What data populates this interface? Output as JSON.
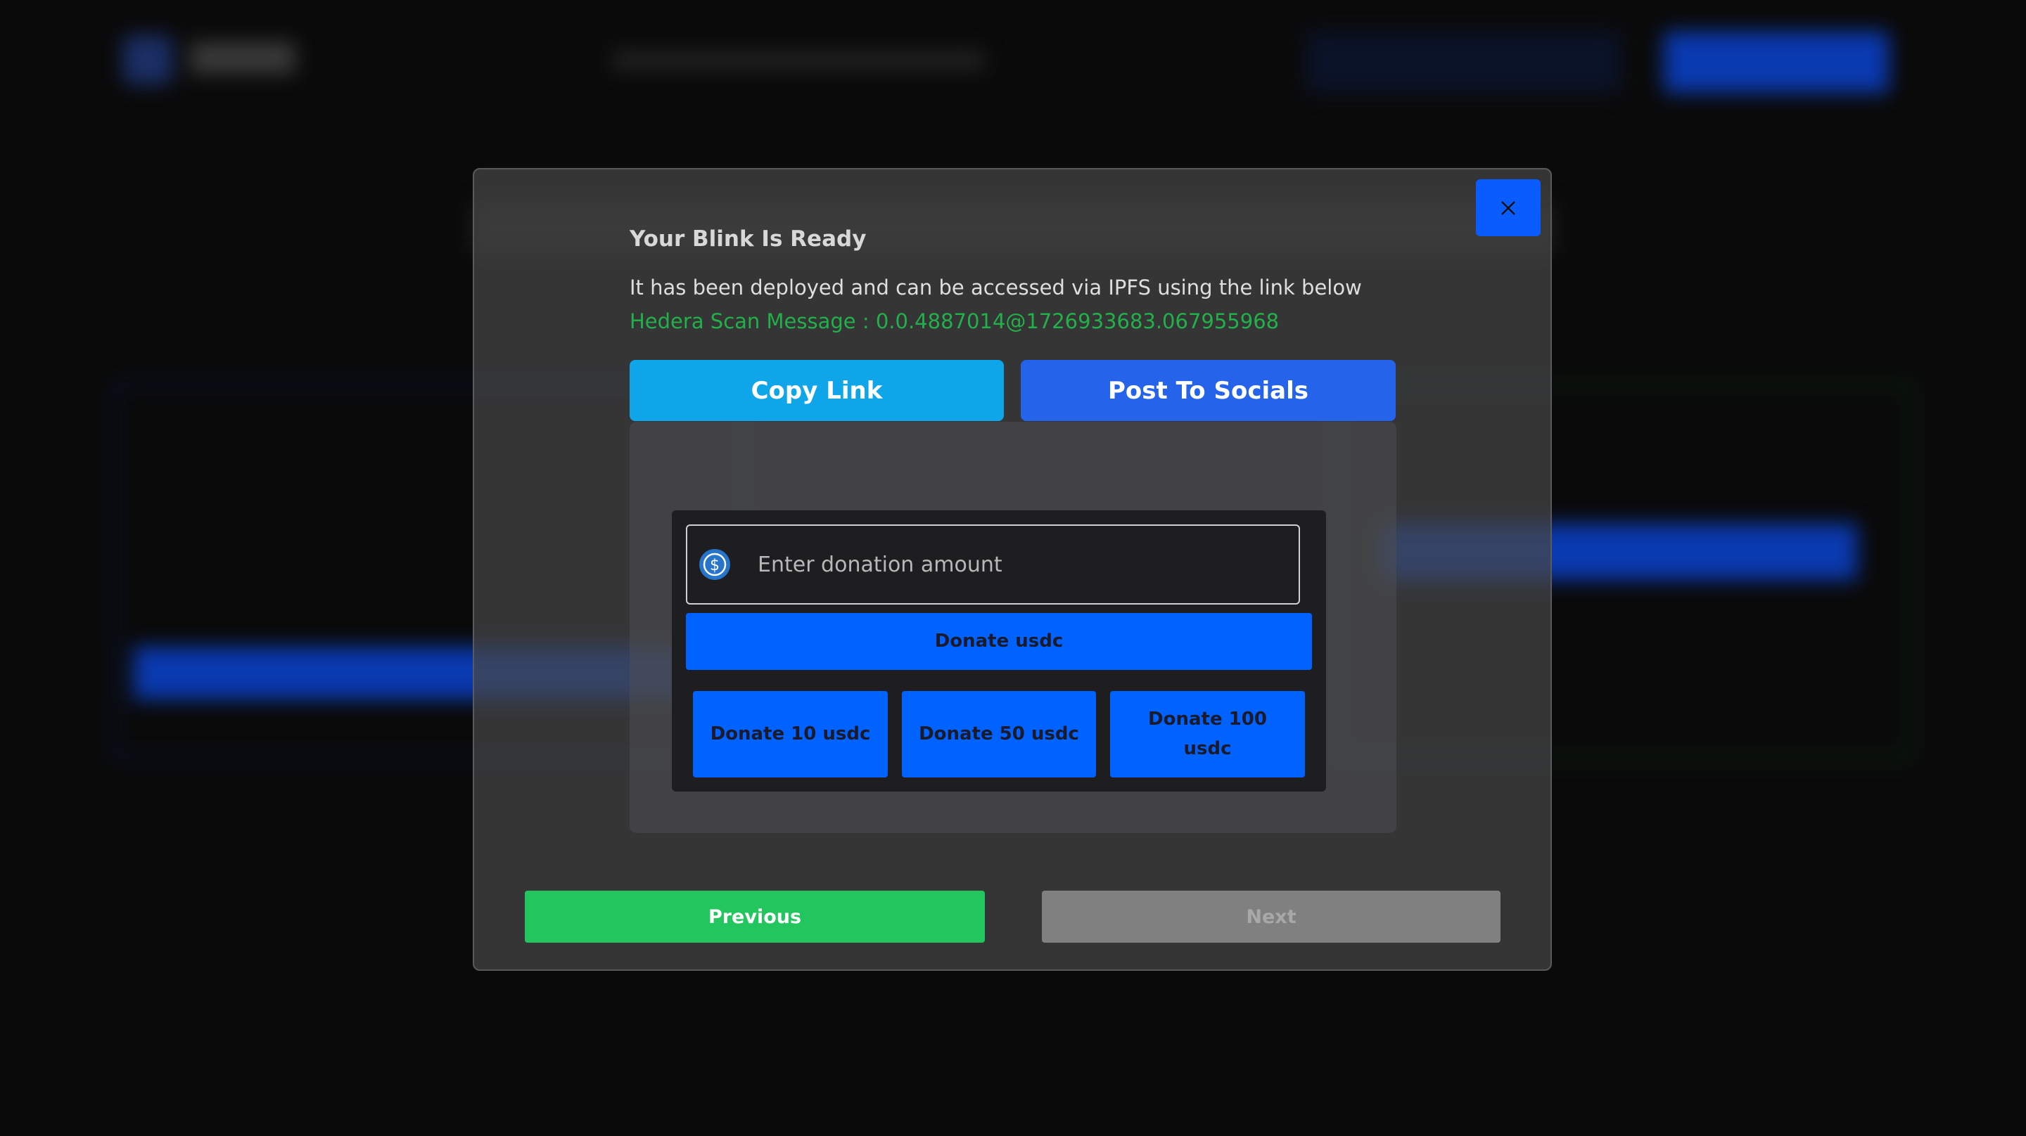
{
  "modal": {
    "title": "Your Blink Is Ready",
    "description": "It has been deployed and can be accessed via IPFS using the link below",
    "hedera_message": "Hedera Scan Message : 0.0.4887014@1726933683.067955968",
    "copy_link_label": "Copy Link",
    "post_socials_label": "Post To Socials",
    "close_icon": "close-icon"
  },
  "donation": {
    "placeholder": "Enter donation amount",
    "token_icon": "usdc-icon",
    "donate_label": "Donate usdc",
    "presets": [
      "Donate 10 usdc",
      "Donate 50 usdc",
      "Donate 100 usdc"
    ]
  },
  "nav": {
    "previous_label": "Previous",
    "next_label": "Next"
  },
  "colors": {
    "accent": "#0a5cff",
    "copy": "#0ea5e9",
    "post": "#2563eb",
    "success": "#22c55e",
    "hedera_text": "#22b04a",
    "disabled": "#808080"
  }
}
